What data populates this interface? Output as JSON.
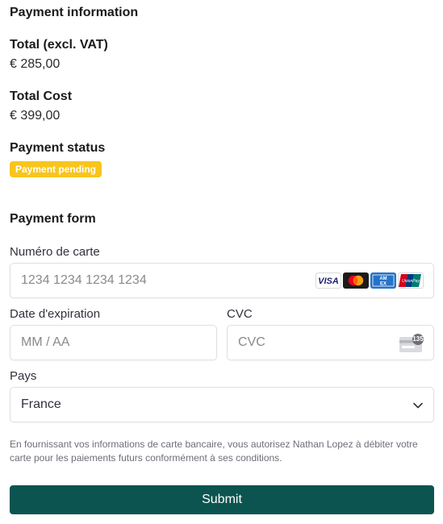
{
  "payment_info": {
    "heading": "Payment information",
    "total_excl_vat_label": "Total (excl. VAT)",
    "total_excl_vat_value": "€ 285,00",
    "total_cost_label": "Total Cost",
    "total_cost_value": "€ 399,00",
    "status_label": "Payment status",
    "status_badge": "Payment pending",
    "status_color": "#f8c51c"
  },
  "payment_form": {
    "heading": "Payment form",
    "card_number": {
      "label": "Numéro de carte",
      "placeholder": "1234 1234 1234 1234",
      "brand_icons": [
        "visa-icon",
        "mastercard-icon",
        "amex-icon",
        "unionpay-icon"
      ]
    },
    "expiry": {
      "label": "Date d'expiration",
      "placeholder": "MM / AA"
    },
    "cvc": {
      "label": "CVC",
      "placeholder": "CVC",
      "icon": "cvc-card-icon",
      "icon_text": "135"
    },
    "country": {
      "label": "Pays",
      "value": "France"
    },
    "disclaimer": "En fournissant vos informations de carte bancaire, vous autorisez Nathan Lopez à débiter votre carte pour les paiements futurs conformément à ses conditions.",
    "submit_label": "Submit",
    "submit_color": "#0c5450"
  }
}
